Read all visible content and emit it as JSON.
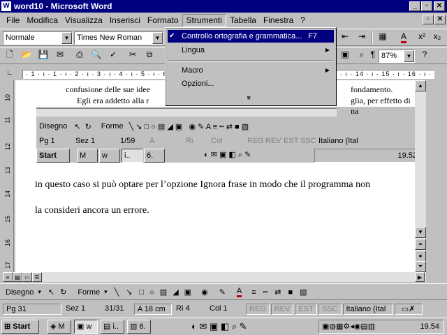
{
  "window": {
    "title": "word10 - Microsoft Word",
    "icon": "W"
  },
  "menubar": [
    "File",
    "Modifica",
    "Visualizza",
    "Inserisci",
    "Formato",
    "Strumenti",
    "Tabella",
    "Finestra",
    "?"
  ],
  "formatting": {
    "style": "Normale",
    "font": "Times New Roman"
  },
  "standard": {
    "zoom": "87%"
  },
  "ruler": "· 1 · ı · 1 · ı · 2 · ı · 3 · ı · 4 · ı · 5 · ı · 6 · ı · 7 · ı · 8 · ı · 9 · ı · 10 · ı · 11 · ı · 12 · ı · 13 · ı · 14 · ı · 15 · ı · 16 · ı · 17",
  "vruler": [
    "10",
    "11",
    "12",
    "13",
    "14",
    "15",
    "16",
    "17"
  ],
  "inner": {
    "line1": "confusione delle sue idee",
    "line1_end": "fondamento.",
    "line2": "Egli era addetto alla r",
    "line2_end": "glia, per effetto di na",
    "drawing": {
      "disegno": "Disegno",
      "forme": "Forme"
    },
    "status": {
      "pg": "Pg 1",
      "sez": "Sez 1",
      "pages": "1/59",
      "a": "A",
      "ri": "Ri",
      "col": "Col",
      "reg": "REG",
      "rev": "REV",
      "est": "EST",
      "ssc": "SSC",
      "lang": "Italiano (Ital"
    },
    "taskbar": {
      "start": "Start",
      "t1": "M",
      "t2": "w",
      "t3": "i..",
      "t4": "6.",
      "time": "19.52"
    }
  },
  "document": {
    "line1": "in questo caso si può optare per l’opzione Ignora frase in modo che il programma non",
    "line2": "la consideri ancora un errore."
  },
  "drawing": {
    "disegno": "Disegno",
    "forme": "Forme"
  },
  "status": {
    "pg": "Pg 31",
    "sez": "Sez 1",
    "pages": "31/31",
    "a": "A 18 cm",
    "ri": "Ri 4",
    "col": "Col 1",
    "reg": "REG",
    "rev": "REV",
    "est": "EST",
    "ssc": "SSC",
    "lang": "Italiano (Ital"
  },
  "taskbar": {
    "start": "Start",
    "t1": "M",
    "t2": "w",
    "t3": "i..",
    "t4": "6.",
    "time": "19.54"
  },
  "menu": {
    "items": [
      {
        "label": "Controllo ortografia e grammatica...",
        "shortcut": "F7"
      },
      {
        "label": "Lingua"
      },
      {
        "label": "Macro"
      },
      {
        "label": "Opzioni..."
      }
    ],
    "expand": "»"
  },
  "colors": {
    "titlebar": "#000080",
    "face": "#c0c0c0",
    "highlight": "#000080"
  }
}
